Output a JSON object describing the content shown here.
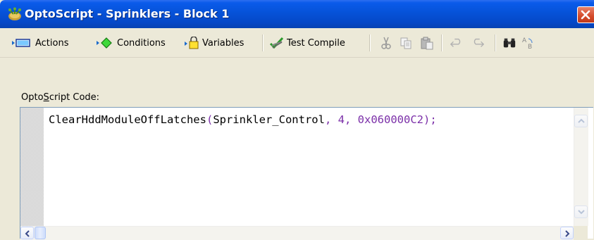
{
  "window": {
    "title": "OptoScript - Sprinklers - Block 1"
  },
  "toolbar": {
    "actions_label": "Actions",
    "conditions_label": "Conditions",
    "variables_label": "Variables",
    "test_compile_label": "Test Compile"
  },
  "editor": {
    "label_prefix": "Opto",
    "label_mnemonic": "S",
    "label_suffix": "cript Code:",
    "code": {
      "function": "ClearHddModuleOffLatches",
      "open_paren": "(",
      "arg1": "Sprinkler_Control",
      "comma1": ",",
      "arg2": "4",
      "comma2": ",",
      "arg3": "0x060000C2",
      "close": ");"
    }
  },
  "colors": {
    "titlebar": "#0652d8",
    "syntax_keyword": "#7b2fa8",
    "window_bg": "#ece9d8"
  }
}
